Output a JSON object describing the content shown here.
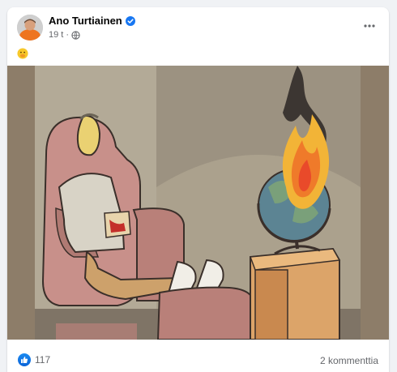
{
  "post": {
    "author": "Ano Turtiainen",
    "time": "19 t",
    "separator": "·",
    "emoji": "🫢",
    "likes": "117",
    "comments": "2 kommenttia"
  },
  "icons": {
    "verified": "verified-badge-icon",
    "privacy": "globe-icon",
    "more": "more-options-icon",
    "like": "thumbs-up-icon"
  },
  "colors": {
    "brand_blue": "#1877f2",
    "text_primary": "#050505",
    "text_secondary": "#65676b",
    "background": "#f0f2f5"
  }
}
